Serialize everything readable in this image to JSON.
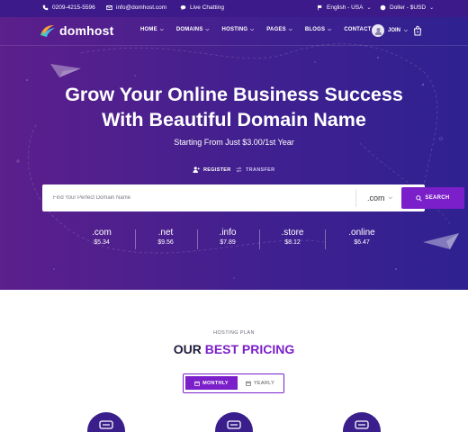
{
  "topbar": {
    "phone": "0209-4215-5596",
    "email": "info@domhost.com",
    "chat": "Live Chatting",
    "language": "English - USA",
    "currency": "Doller - $USD"
  },
  "nav": {
    "logo": "domhost",
    "items": [
      {
        "label": "HOME",
        "dropdown": true
      },
      {
        "label": "DOMAINS",
        "dropdown": true
      },
      {
        "label": "HOSTING",
        "dropdown": true
      },
      {
        "label": "PAGES",
        "dropdown": true
      },
      {
        "label": "BLOGS",
        "dropdown": true
      },
      {
        "label": "CONTACT",
        "dropdown": false
      }
    ],
    "join": "JOIN"
  },
  "hero": {
    "title_line1": "Grow Your Online Business Success",
    "title_line2": "With Beautiful Domain Name",
    "subtitle": "Starting From Just $3.00/1st Year",
    "register": "REGISTER",
    "transfer": "TRANSFER",
    "search_placeholder": "Find Your Perfect Domain Name",
    "tld_selected": ".com",
    "search_button": "SEARCH",
    "prices": [
      {
        "ext": ".com",
        "price": "$5.34"
      },
      {
        "ext": ".net",
        "price": "$9.56"
      },
      {
        "ext": ".info",
        "price": "$7.89"
      },
      {
        "ext": ".store",
        "price": "$8.12"
      },
      {
        "ext": ".online",
        "price": "$6.47"
      }
    ]
  },
  "pricing": {
    "label": "HOSTING PLAN",
    "title_plain": "OUR ",
    "title_accent": "BEST PRICING",
    "monthly": "MONTHLY",
    "yearly": "YEARLY"
  },
  "colors": {
    "topbar": "#3c1a8a",
    "accent": "#7a1fc9",
    "hero_left": "#5c1f8c",
    "hero_right": "#2f2191"
  }
}
